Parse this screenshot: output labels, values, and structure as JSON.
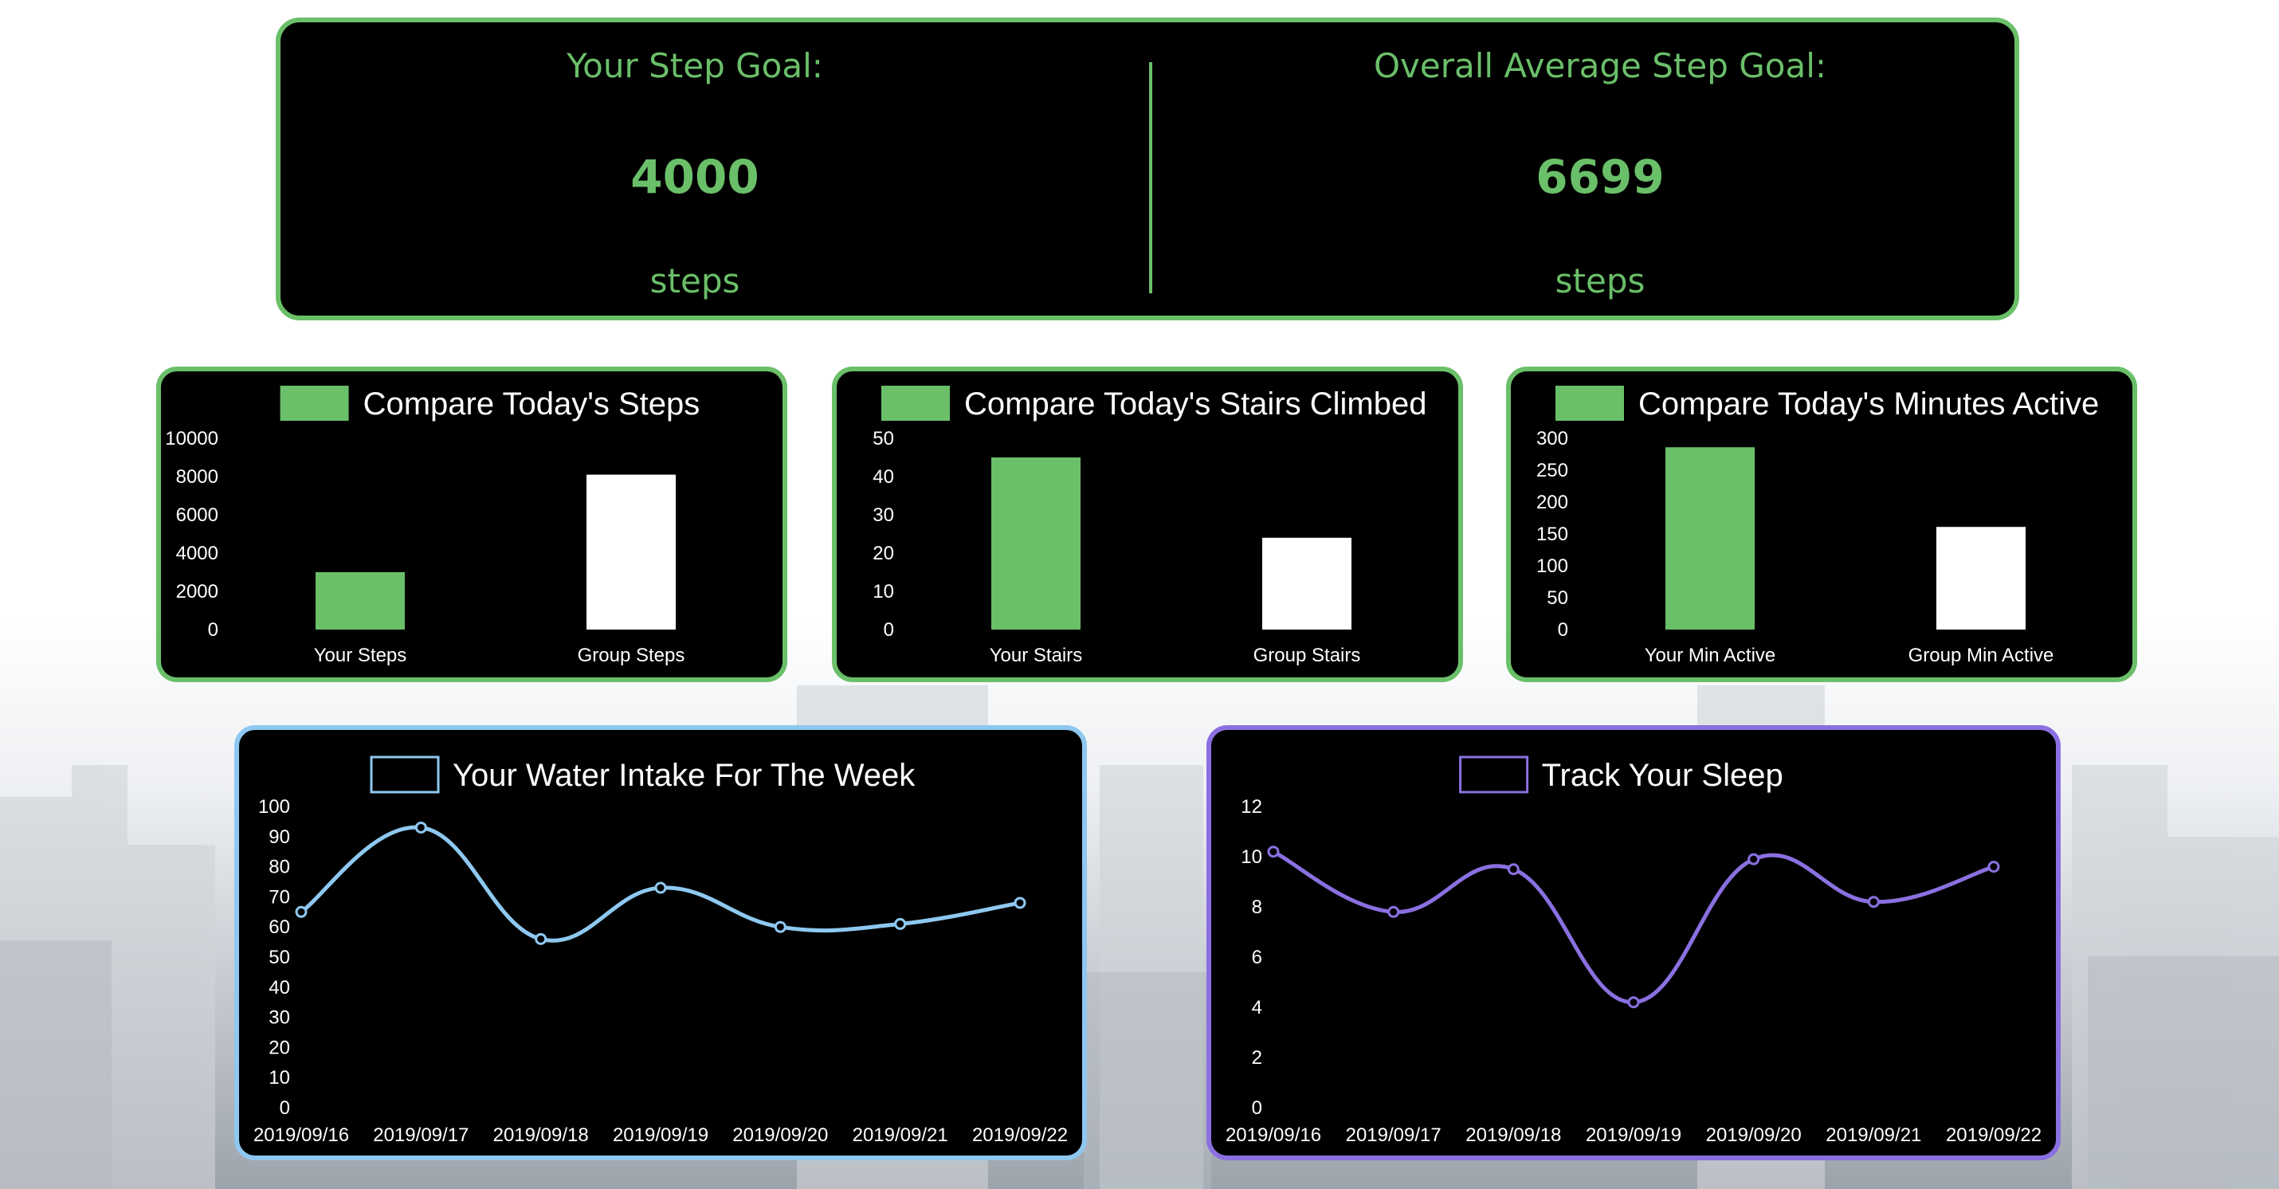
{
  "step_goal": {
    "yours": {
      "title": "Your Step Goal:",
      "value": "4000",
      "unit": "steps"
    },
    "overall": {
      "title": "Overall Average Step Goal:",
      "value": "6699",
      "unit": "steps"
    }
  },
  "colors": {
    "green": "#6abf69",
    "white": "#ffffff",
    "water": "#8ec8f0",
    "sleep": "#8a70e0"
  },
  "chart_data": [
    {
      "id": "steps",
      "type": "bar",
      "title": "Compare Today's Steps",
      "legend_color": "#6abf69",
      "categories": [
        "Your Steps",
        "Group Steps"
      ],
      "values": [
        3000,
        8100
      ],
      "bar_colors": [
        "#6abf69",
        "#ffffff"
      ],
      "ylim": [
        0,
        10000
      ],
      "yticks": [
        "0",
        "2000",
        "4000",
        "6000",
        "8000",
        "10000"
      ],
      "legend_position": "top"
    },
    {
      "id": "stairs",
      "type": "bar",
      "title": "Compare Today's Stairs Climbed",
      "legend_color": "#6abf69",
      "categories": [
        "Your Stairs",
        "Group Stairs"
      ],
      "values": [
        45,
        24
      ],
      "bar_colors": [
        "#6abf69",
        "#ffffff"
      ],
      "ylim": [
        0,
        50
      ],
      "yticks": [
        "0",
        "10",
        "20",
        "30",
        "40",
        "50"
      ],
      "legend_position": "top"
    },
    {
      "id": "minutes",
      "type": "bar",
      "title": "Compare Today's Minutes Active",
      "legend_color": "#6abf69",
      "categories": [
        "Your Min Active",
        "Group Min Active"
      ],
      "values": [
        286,
        161
      ],
      "bar_colors": [
        "#6abf69",
        "#ffffff"
      ],
      "ylim": [
        0,
        300
      ],
      "yticks": [
        "0",
        "50",
        "100",
        "150",
        "200",
        "250",
        "300"
      ],
      "legend_position": "top"
    },
    {
      "id": "water",
      "type": "line",
      "title": "Your Water Intake For The Week",
      "legend_color": "#8ec8f0",
      "x": [
        "2019/09/16",
        "2019/09/17",
        "2019/09/18",
        "2019/09/19",
        "2019/09/20",
        "2019/09/21",
        "2019/09/22"
      ],
      "values": [
        65,
        93,
        56,
        73,
        60,
        61,
        68
      ],
      "ylim": [
        0,
        100
      ],
      "yticks": [
        "0",
        "10",
        "20",
        "30",
        "40",
        "50",
        "60",
        "70",
        "80",
        "90",
        "100"
      ],
      "legend_position": "top"
    },
    {
      "id": "sleep",
      "type": "line",
      "title": "Track Your Sleep",
      "legend_color": "#8a70e0",
      "x": [
        "2019/09/16",
        "2019/09/17",
        "2019/09/18",
        "2019/09/19",
        "2019/09/20",
        "2019/09/21",
        "2019/09/22"
      ],
      "values": [
        10.2,
        7.8,
        9.5,
        4.2,
        9.9,
        8.2,
        9.6
      ],
      "ylim": [
        0,
        12
      ],
      "yticks": [
        "0",
        "2",
        "4",
        "6",
        "8",
        "10",
        "12"
      ],
      "legend_position": "top"
    }
  ]
}
